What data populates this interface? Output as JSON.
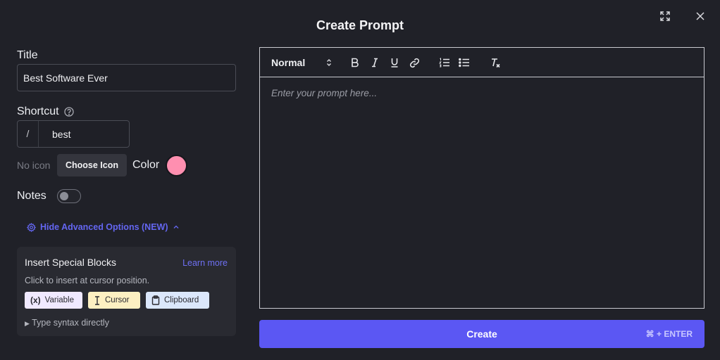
{
  "dialog": {
    "title": "Create Prompt"
  },
  "form": {
    "title_label": "Title",
    "title_value": "Best Software Ever",
    "shortcut_label": "Shortcut",
    "shortcut_prefix": "/",
    "shortcut_value": "best",
    "no_icon_text": "No icon",
    "choose_icon_label": "Choose Icon",
    "color_label": "Color",
    "color_value": "#ff8fb0",
    "notes_label": "Notes",
    "notes_enabled": false
  },
  "advanced": {
    "toggle_label": "Hide Advanced Options (NEW)",
    "card_title": "Insert Special Blocks",
    "learn_more": "Learn more",
    "card_subtitle": "Click to insert at cursor position.",
    "chips": [
      {
        "label": "Variable",
        "icon": "variable-icon",
        "color": "#f0e9ff"
      },
      {
        "label": "Cursor",
        "icon": "text-cursor-icon",
        "color": "#fdf0c2"
      },
      {
        "label": "Clipboard",
        "icon": "clipboard-icon",
        "color": "#dbe7fb"
      }
    ],
    "syntax_label": "Type syntax directly"
  },
  "editor": {
    "format_value": "Normal",
    "toolbar_icons": [
      "bold-icon",
      "italic-icon",
      "underline-icon",
      "link-icon",
      "ordered-list-icon",
      "bullet-list-icon",
      "clear-format-icon"
    ],
    "placeholder": "Enter your prompt here..."
  },
  "actions": {
    "create_label": "Create",
    "create_shortcut": "⌘ + ENTER"
  },
  "colors": {
    "accent": "#5b57f3",
    "link": "#6466f1",
    "background": "#202128"
  }
}
